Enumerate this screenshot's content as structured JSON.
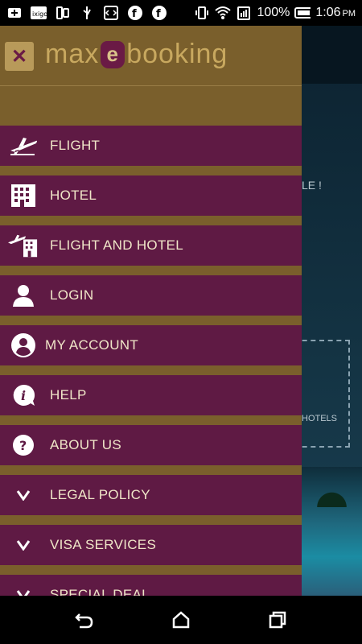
{
  "status_bar": {
    "battery_percent": "100%",
    "time": "1:06",
    "ampm": "PM",
    "notification_icons": [
      "add-icon",
      "ixigo-icon",
      "sim-icon",
      "usb-icon",
      "code-icon",
      "fb-lite-icon",
      "fb-lite-icon"
    ]
  },
  "brand": {
    "logo_text_left": "max",
    "logo_mark": "e",
    "logo_text_right": "booking",
    "accent_color": "#c8a85f",
    "drawer_color": "#5f1a44",
    "separator_color": "#7a5f2c"
  },
  "menu": {
    "items": [
      {
        "label": "FLIGHT",
        "icon": "plane-icon"
      },
      {
        "label": "HOTEL",
        "icon": "building-icon"
      },
      {
        "label": "FLIGHT AND HOTEL",
        "icon": "plane-building-icon"
      },
      {
        "label": "LOGIN",
        "icon": "person-icon"
      },
      {
        "label": "MY ACCOUNT",
        "icon": "account-circle-icon"
      },
      {
        "label": "HELP",
        "icon": "info-bubble-icon"
      },
      {
        "label": "ABOUT US",
        "icon": "question-circle-icon"
      },
      {
        "label": "LEGAL POLICY",
        "icon": "chevron-down-icon"
      },
      {
        "label": "VISA SERVICES",
        "icon": "chevron-down-icon"
      },
      {
        "label": "SPECIAL DEAL",
        "icon": "chevron-down-icon"
      }
    ]
  },
  "background_app": {
    "promo_text_fragment": "LE !",
    "hotels_label_fragment": "HOTELS"
  }
}
